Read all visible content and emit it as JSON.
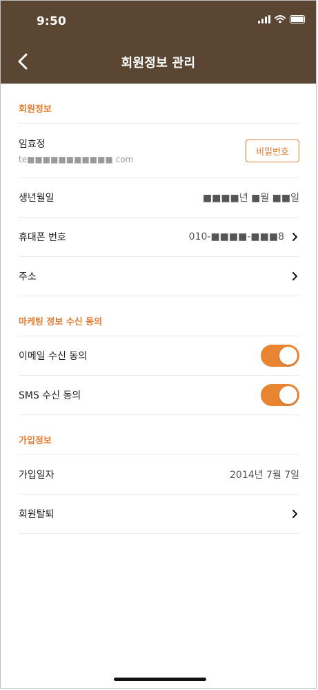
{
  "status": {
    "time": "9:50"
  },
  "header": {
    "title": "회원정보 관리"
  },
  "sections": {
    "member": {
      "title": "회원정보",
      "name": "임효정",
      "email_visible": "te■■■■■■■■■■■ com",
      "password_button": "비밀번호",
      "birth_label": "생년월일",
      "birth_value": "■■■■년 ■월 ■■일",
      "phone_label": "휴대폰 번호",
      "phone_value": "010-■■■■-■■■8",
      "address_label": "주소"
    },
    "marketing": {
      "title": "마케팅 정보 수신 동의",
      "email_label": "이메일 수신 동의",
      "sms_label": "SMS 수신 동의"
    },
    "signup": {
      "title": "가입정보",
      "date_label": "가입일자",
      "date_value": "2014년 7월 7일",
      "withdraw_label": "회원탈퇴"
    }
  }
}
